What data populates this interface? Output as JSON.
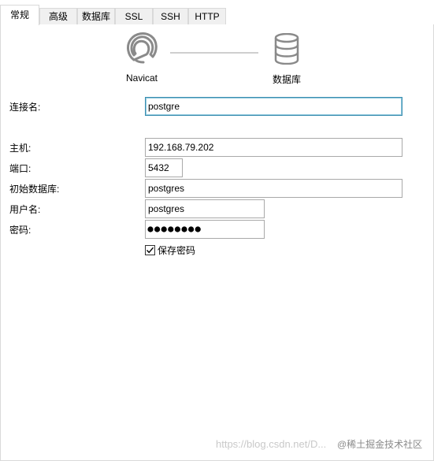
{
  "tabs": [
    {
      "label": "常规",
      "active": true
    },
    {
      "label": "高级",
      "active": false
    },
    {
      "label": "数据库",
      "active": false
    },
    {
      "label": "SSL",
      "active": false
    },
    {
      "label": "SSH",
      "active": false
    },
    {
      "label": "HTTP",
      "active": false
    }
  ],
  "diagram": {
    "left_caption": "Navicat",
    "right_caption": "数据库",
    "left_icon": "navicat-logo-icon",
    "right_icon": "database-icon"
  },
  "form": {
    "connection_name": {
      "label": "连接名:",
      "value": "postgre"
    },
    "host": {
      "label": "主机:",
      "value": "192.168.79.202"
    },
    "port": {
      "label": "端口:",
      "value": "5432"
    },
    "initial_database": {
      "label": "初始数据库:",
      "value": "postgres"
    },
    "username": {
      "label": "用户名:",
      "value": "postgres"
    },
    "password": {
      "label": "密码:",
      "masked_length": 8
    },
    "save_password": {
      "label": "保存密码",
      "checked": true
    }
  },
  "watermark": {
    "text": "https://blog.csdn.net/D...",
    "badge": "@稀土掘金技术社区"
  },
  "colors": {
    "tab_inactive_bg": "#f0f0f0",
    "border": "#d9d9d9",
    "focus_border": "#3d8fb0",
    "icon_gray": "#8a8a8a"
  }
}
